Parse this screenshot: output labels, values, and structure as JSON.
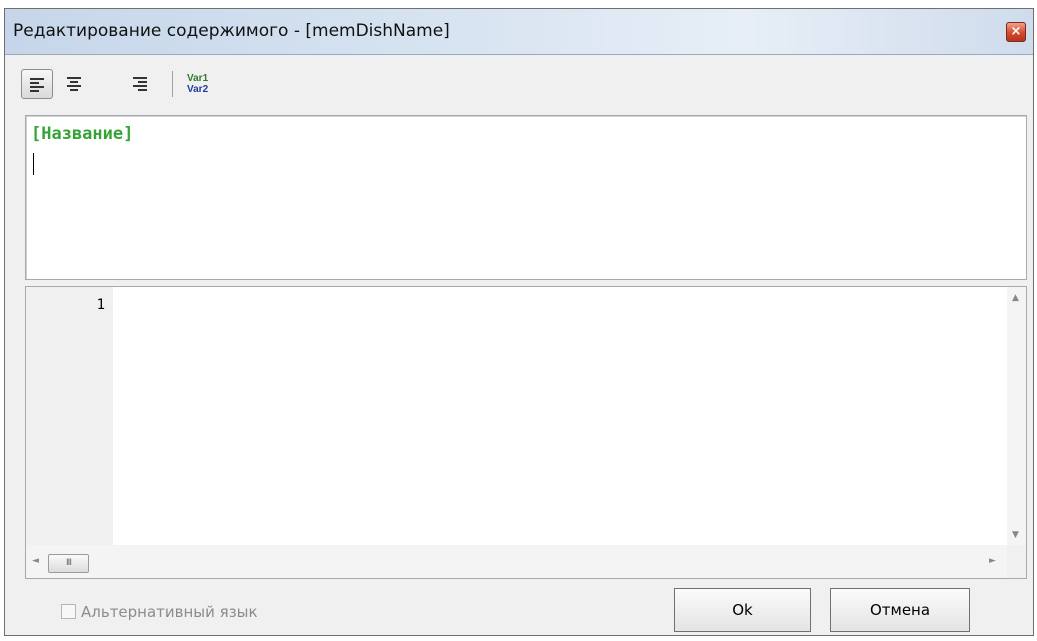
{
  "window": {
    "title": "Редактирование содержимого - [memDishName]",
    "close_glyph": "×"
  },
  "toolbar": {
    "buttons": [
      {
        "name": "align-left",
        "icon": "align-left-icon",
        "pressed": true
      },
      {
        "name": "align-center",
        "icon": "align-center-icon",
        "pressed": false
      },
      {
        "name": "align-right",
        "icon": "align-right-icon",
        "pressed": false
      }
    ],
    "var1": "Var1",
    "var2": "Var2"
  },
  "preview": {
    "text": "[Название]"
  },
  "editor": {
    "line_numbers": [
      "1"
    ],
    "scroll_up": "▲",
    "scroll_down": "▼",
    "scroll_left": "◄",
    "scroll_right": "►",
    "thumb_grip": "III"
  },
  "footer": {
    "alt_language_label": "Альтернативный язык",
    "alt_language_checked": false,
    "ok_label": "Ok",
    "cancel_label": "Отмена"
  },
  "colors": {
    "preview_text": "#36a336",
    "var1": "#2f7a2f",
    "var2": "#1f3d9a",
    "close_button": "#d24a30"
  }
}
